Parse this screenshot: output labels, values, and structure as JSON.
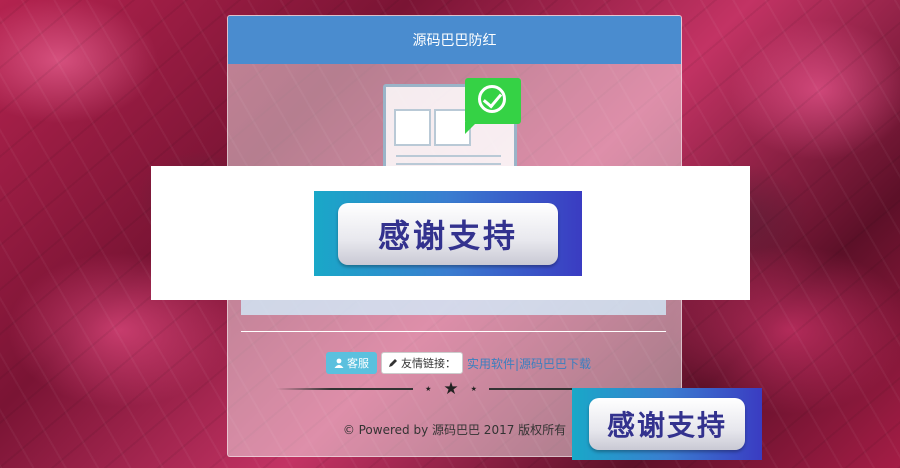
{
  "header": {
    "title": "源码巴巴防红"
  },
  "links": {
    "kefu_label": "客服",
    "friend_links_label": "友情链接：",
    "link_text": "实用软件|源码巴巴下载"
  },
  "footer": {
    "text": "© Powered by 源码巴巴 2017 版权所有"
  },
  "banners": {
    "main_text": "感谢支持",
    "corner_text": "感谢支持"
  },
  "icons": {
    "kefu": "user-icon",
    "friend_links": "pencil-icon",
    "success": "check-icon",
    "divider": "star-icon"
  },
  "colors": {
    "header_bg": "#4a8ccf",
    "kefu_btn": "#5bc0de",
    "check_green": "#35d245",
    "link_blue": "#3b7fbf"
  }
}
